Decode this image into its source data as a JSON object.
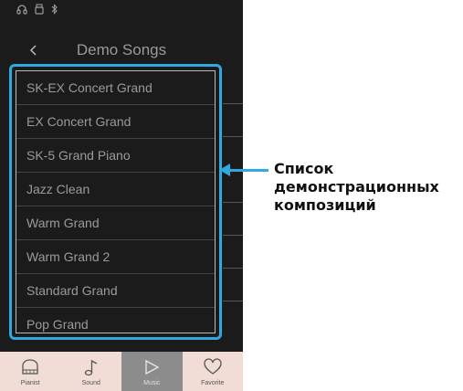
{
  "header": {
    "title": "Demo Songs"
  },
  "songs": [
    {
      "label": "SK-EX Concert Grand"
    },
    {
      "label": "EX Concert Grand"
    },
    {
      "label": "SK-5 Grand Piano"
    },
    {
      "label": "Jazz Clean"
    },
    {
      "label": "Warm Grand"
    },
    {
      "label": "Warm Grand 2"
    },
    {
      "label": "Standard Grand"
    },
    {
      "label": "Pop Grand"
    }
  ],
  "bottom_nav": [
    {
      "label": "Pianist",
      "icon": "piano-icon"
    },
    {
      "label": "Sound",
      "icon": "music-note-icon"
    },
    {
      "label": "Music",
      "icon": "play-icon",
      "active": true
    },
    {
      "label": "Favorite",
      "icon": "heart-icon"
    }
  ],
  "callout": {
    "text": "Список\nдемонстрационных\nкомпозиций"
  },
  "colors": {
    "accent": "#2fa9e0",
    "screen_bg": "#1b1b1b",
    "nav_bg": "#f1ddd5"
  }
}
